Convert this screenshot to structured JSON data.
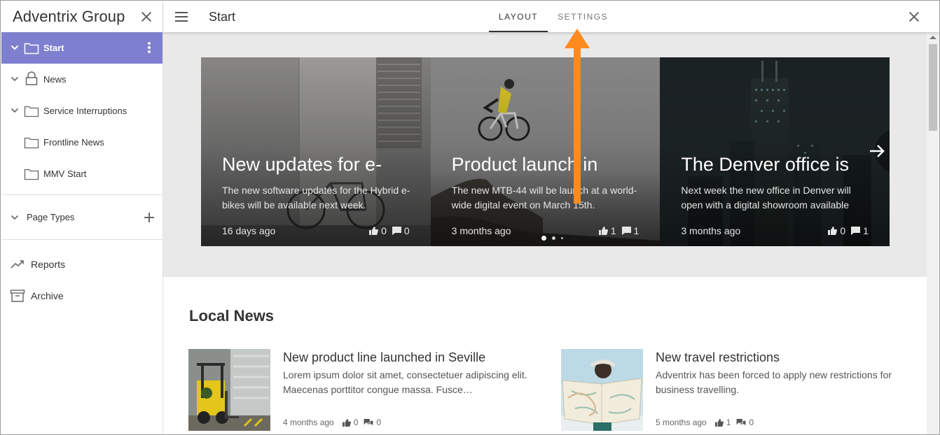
{
  "sidebar": {
    "title": "Adventrix Group",
    "items": [
      {
        "label": "Start",
        "icon": "folder-icon"
      },
      {
        "label": "News",
        "icon": "lock-icon"
      },
      {
        "label": "Service Interruptions",
        "icon": "folder-icon"
      },
      {
        "label": "Frontline News",
        "icon": "folder-icon"
      },
      {
        "label": "MMV Start",
        "icon": "folder-icon"
      }
    ],
    "page_types": "Page Types",
    "links": [
      {
        "label": "Reports",
        "icon": "trending-up-icon"
      },
      {
        "label": "Archive",
        "icon": "archive-box-icon"
      }
    ],
    "active_color": "#7f7fcf"
  },
  "topbar": {
    "title": "Start",
    "tabs": [
      {
        "label": "LAYOUT"
      },
      {
        "label": "SETTINGS"
      }
    ]
  },
  "carousel": {
    "slides": [
      {
        "title": "New updates for e-",
        "summary": "The new software updates for the Hybrid e-bikes will be available next week.",
        "age": "16 days ago",
        "likes": "0",
        "comments": "0"
      },
      {
        "title": "Product launch in",
        "summary": "The new MTB-44 will be launch at a world-wide digital event on March 15th.",
        "age": "3 months ago",
        "likes": "1",
        "comments": "1"
      },
      {
        "title": "The Denver office is",
        "summary": "Next week the new office in Denver will open with a digital showroom available",
        "age": "3 months ago",
        "likes": "0",
        "comments": "1"
      }
    ]
  },
  "local_news": {
    "title": "Local News",
    "items": [
      {
        "title": "New product line launched in Seville",
        "summary": "Lorem ipsum dolor sit amet, consectetuer adipiscing elit. Maecenas porttitor congue massa. Fusce…",
        "age": "4 months ago",
        "likes": "0",
        "comments": "0"
      },
      {
        "title": "New travel restrictions",
        "summary": "Adventrix has been forced to apply new restrictions for business travelling.",
        "age": "5 months ago",
        "likes": "1",
        "comments": "0"
      }
    ]
  },
  "annotation": {
    "color": "#ff8a1e"
  }
}
